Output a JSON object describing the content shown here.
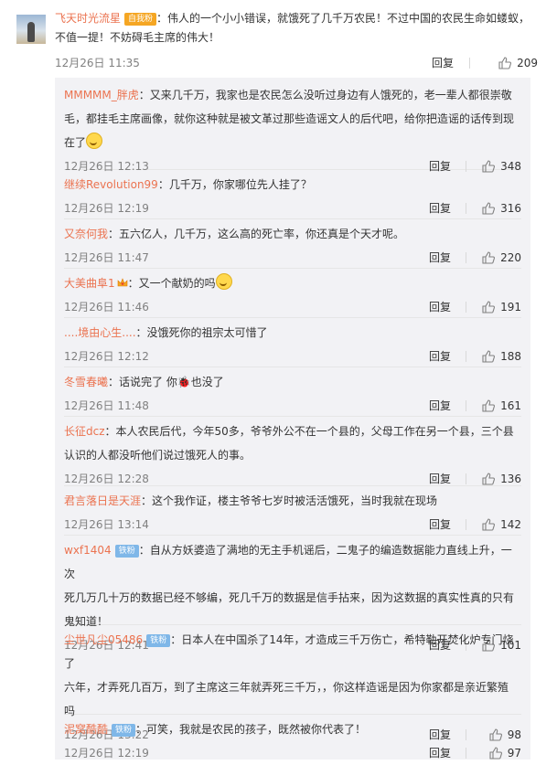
{
  "main_comment": {
    "user": "飞天时光流星",
    "badge": "自我粉",
    "text_line1": "：伟人的一个小小错误，就饿死了几千万农民！不过中国的农民生命如蝼蚁，",
    "text_line2": "不值一提！不妨碍毛主席的伟大！",
    "time": "12月26日 11:35",
    "reply_label": "回复",
    "likes": "209"
  },
  "replies": [
    {
      "user": "MMMMM_胖虎",
      "lines": [
        "：又来几千万，我家也是农民怎么没听过身边有人饿死的，老一辈人都很崇敬",
        "毛，都挂毛主席画像，就你这种就是被文革过那些造谣文人的后代吧，给你把造谣的话传到现",
        "在了"
      ],
      "time": "12月26日 12:13",
      "reply_label": "回复",
      "likes": "348"
    },
    {
      "user": "继续Revolution99",
      "lines": [
        "：几千万，你家哪位先人挂了？"
      ],
      "time": "12月26日 12:19",
      "reply_label": "回复",
      "likes": "316"
    },
    {
      "user": "又奈何我",
      "lines": [
        "：五六亿人，几千万，这么高的死亡率，你还真是个天才呢。"
      ],
      "time": "12月26日 11:47",
      "reply_label": "回复",
      "likes": "220"
    },
    {
      "user": "大美曲阜1",
      "lines": [
        "：又一个献奶的吗"
      ],
      "time": "12月26日 11:46",
      "reply_label": "回复",
      "likes": "191"
    },
    {
      "user": "....境由心生....",
      "lines": [
        "：没饿死你的祖宗太可惜了"
      ],
      "time": "12月26日 12:12",
      "reply_label": "回复",
      "likes": "188"
    },
    {
      "user": "冬雪春曦",
      "lines": [
        "：话说完了 你",
        "也没了"
      ],
      "time": "12月26日 11:48",
      "reply_label": "回复",
      "likes": "161"
    },
    {
      "user": "长征dcz",
      "lines": [
        "：本人农民后代，今年50多，爷爷外公不在一个县的，父母工作在另一个县，三个县",
        "认识的人都没听他们说过饿死人的事。"
      ],
      "time": "12月26日 12:28",
      "reply_label": "回复",
      "likes": "136"
    },
    {
      "user": "君言落日是天涯",
      "lines": [
        "：这个我作证，楼主爷爷七岁时被活活饿死，当时我就在现场"
      ],
      "time": "12月26日 13:14",
      "reply_label": "回复",
      "likes": "142"
    },
    {
      "user": "wxf1404",
      "badge": "铁粉",
      "lines": [
        "：自从方妖婆造了满地的无主手机谣后，二鬼子的编造数据能力直线上升，一次",
        "死几万几十万的数据已经不够编，死几千万的数据是信手拈来，因为这数据的真实性真的只有",
        "鬼知道！"
      ],
      "time": "12月26日 12:41",
      "reply_label": "回复",
      "likes": "101"
    },
    {
      "user": "尘世凡尘05486",
      "badge": "铁粉",
      "lines": [
        "：日本人在中国杀了14年，才造成三千万伤亡，希特勒开焚化炉专门烧了",
        "六年，才弄死几百万，到了主席这三年就弄死三千万，，你这样造谣是因为你家都是亲近繁殖",
        "吗"
      ],
      "time": "12月26日 13:22",
      "reply_label": "回复",
      "likes": "98"
    },
    {
      "user": "泥窝酷酷",
      "badge": "铁粉",
      "lines": [
        "：可笑，我就是农民的孩子，既然被你代表了！"
      ],
      "time": "12月26日 12:19",
      "reply_label": "回复",
      "likes": "97"
    }
  ],
  "colors": {
    "username": "#eb7350",
    "text": "#333333",
    "time": "#808080",
    "reply_bg": "#f2f2f5"
  }
}
